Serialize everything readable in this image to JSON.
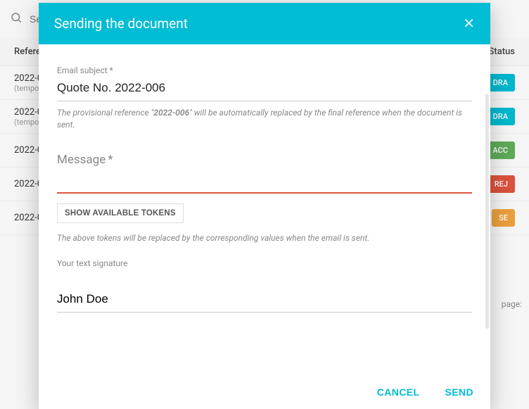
{
  "background": {
    "search_placeholder": "Search",
    "table_headers": {
      "reference": "Reference",
      "status": "Status"
    },
    "rows": [
      {
        "ref": "2022-0",
        "temp": "(tempo",
        "badge": "DRA",
        "badge_class": "draft"
      },
      {
        "ref": "2022-0",
        "temp": "(tempo",
        "badge": "DRA",
        "badge_class": "draft"
      },
      {
        "ref": "2022-0",
        "temp": "",
        "badge": "ACC",
        "badge_class": "accepted"
      },
      {
        "ref": "2022-0",
        "temp": "",
        "badge": "REJ",
        "badge_class": "rejected"
      },
      {
        "ref": "2022-0",
        "temp": "",
        "badge": "SE",
        "badge_class": "sent"
      }
    ],
    "footer_text": "page:"
  },
  "modal": {
    "title": "Sending the document",
    "email_subject_label": "Email subject *",
    "email_subject_value": "Quote No. 2022-006",
    "provisional_prefix": "The provisional reference \"",
    "provisional_ref": "2022-006",
    "provisional_suffix": "\" will be automatically replaced by the final reference when the document is sent.",
    "message_label": "Message",
    "message_required_mark": "*",
    "tokens_button": "SHOW AVAILABLE TOKENS",
    "tokens_note": "The above tokens will be replaced by the corresponding values when the email is sent.",
    "signature_label": "Your text signature",
    "signature_value": "John Doe",
    "cancel": "CANCEL",
    "send": "SEND"
  }
}
